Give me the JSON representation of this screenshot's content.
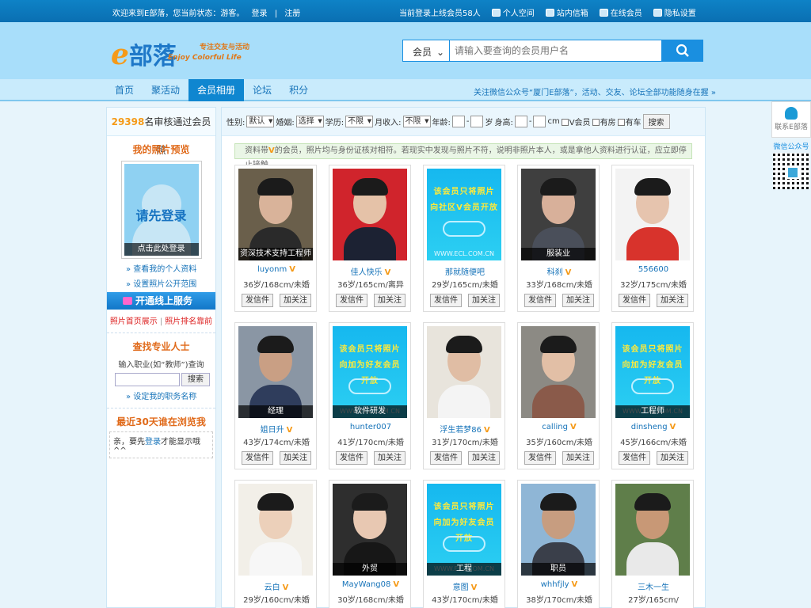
{
  "topbar": {
    "welcome": "欢迎来到E部落，您当前状态：游客。",
    "login": "登录",
    "separator": "|",
    "register": "注册",
    "online_count": "当前登录上线会员58人",
    "links": [
      {
        "icon": "home-icon",
        "label": "个人空间"
      },
      {
        "icon": "mail-icon",
        "label": "站内信箱"
      },
      {
        "icon": "users-icon",
        "label": "在线会员"
      },
      {
        "icon": "gear-icon",
        "label": "隐私设置"
      }
    ]
  },
  "header": {
    "logo_e": "e",
    "logo_text": "部落",
    "slogan": "专注交友与活动",
    "slogan_en": "Enjoy Colorful Life",
    "search_type": "会员",
    "search_placeholder": "请输入要查询的会员用户名",
    "search_icon": "search-icon"
  },
  "nav": {
    "items": [
      "首页",
      "聚活动",
      "会员相册",
      "论坛",
      "积分"
    ],
    "active_index": 2,
    "notice": "关注微信公众号“厦门E部落”，活动、交友、论坛全部功能随身在握 »"
  },
  "sidebar": {
    "count_number": "29398",
    "count_text": "名审核通过会员照",
    "photo_title": "我的照片预览",
    "photo_placeholder": "请先登录",
    "photo_caption": "点击此处登录",
    "link1": "» 查看我的个人资料",
    "link2": "» 设置照片公开范围",
    "service": "开通线上服务",
    "red1": "照片首页展示",
    "red_sep": "|",
    "red2": "照片排名靠前",
    "pro_title": "查找专业人士",
    "pro_hint": "输入职业(如“教师”)查询",
    "pro_search": "搜索",
    "pro_link": "» 设定我的职务名称",
    "recent_title": "最近30天谁在浏览我",
    "recent_prefix": "亲，要先",
    "recent_login": "登录",
    "recent_suffix": "才能显示哦^^"
  },
  "filter": {
    "gender_label": "性别:",
    "gender": "默认",
    "marriage_label": "婚姻:",
    "marriage": "选择",
    "edu_label": "学历:",
    "edu": "不限",
    "income_label": "月收入:",
    "income": "不限",
    "age_label": "年龄:",
    "age_sep": "-",
    "age_unit": "岁",
    "height_label": "身高:",
    "height_sep": "-",
    "height_unit": "cm",
    "check1": "V会员",
    "check2": "有房",
    "check3": "有车",
    "search": "搜索"
  },
  "notice": {
    "pre": "资料带",
    "v": "V",
    "post": "的会员，照片均与身份证核对相符。若现实中发现与照片不符，说明非照片本人，或是拿他人资料进行认证，应立即停止接触"
  },
  "members": [
    {
      "name": "luyonm",
      "vip": "V",
      "info": "36岁/168cm/未婚",
      "caption": "资深技术支持工程师",
      "promo": false,
      "skin": "#d9b39a",
      "bg": "#6a5f4b",
      "shirt": "#2a2a2a"
    },
    {
      "name": "佳人快乐",
      "vip": "V",
      "info": "36岁/165cm/离异",
      "caption": "",
      "promo": false,
      "skin": "#e5c2a8",
      "bg": "#d0242c",
      "shirt": "#1c2233"
    },
    {
      "name": "那就随便吧",
      "vip": "",
      "info": "29岁/165cm/未婚",
      "caption": "",
      "promo": true,
      "promo_text": "该会员只将照片向社区V会员开放",
      "promo_url": "WWW.ECL.COM.CN"
    },
    {
      "name": "科刹",
      "vip": "V",
      "info": "33岁/168cm/未婚",
      "caption": "服装业",
      "promo": false,
      "skin": "#d8b09a",
      "bg": "#3f3f3f",
      "shirt": "#4a4f5a"
    },
    {
      "name": "556600",
      "vip": "",
      "info": "32岁/175cm/未婚",
      "caption": "",
      "promo": false,
      "skin": "#e6c4ae",
      "bg": "#f3f3f3",
      "shirt": "#d8332c"
    },
    {
      "name": "姐日升",
      "vip": "V",
      "info": "43岁/174cm/未婚",
      "caption": "经理",
      "promo": false,
      "skin": "#c99f84",
      "bg": "#8a96a4",
      "shirt": "#2f3d5c"
    },
    {
      "name": "hunter007",
      "vip": "",
      "info": "41岁/170cm/未婚",
      "caption": "软件研发",
      "promo": true,
      "promo_text": "该会员只将照片向加为好友会员开放",
      "promo_url": "WWW.ECL.COM.CN"
    },
    {
      "name": "浮生若梦86",
      "vip": "V",
      "info": "31岁/170cm/未婚",
      "caption": "",
      "promo": false,
      "skin": "#e0bda4",
      "bg": "#e8e4dc",
      "shirt": "#f4f4f4"
    },
    {
      "name": "calling",
      "vip": "V",
      "info": "35岁/160cm/未婚",
      "caption": "",
      "promo": false,
      "skin": "#e2bfa6",
      "bg": "#8c8a84",
      "shirt": "#8a5a4a"
    },
    {
      "name": "dinsheng",
      "vip": "V",
      "info": "45岁/166cm/未婚",
      "caption": "工程师",
      "promo": true,
      "promo_text": "该会员只将照片向加为好友会员开放",
      "promo_url": "WWW.ECL.COM.CN"
    },
    {
      "name": "云白",
      "vip": "V",
      "info": "29岁/160cm/未婚",
      "caption": "",
      "promo": false,
      "skin": "#ecd0ba",
      "bg": "#f2efe8",
      "shirt": "#f7f7f7"
    },
    {
      "name": "MayWang08",
      "vip": "V",
      "info": "30岁/168cm/未婚",
      "caption": "外贸",
      "promo": false,
      "skin": "#e8c8b2",
      "bg": "#2e2e2e",
      "shirt": "#171717"
    },
    {
      "name": "意图",
      "vip": "V",
      "info": "43岁/170cm/未婚",
      "caption": "工程",
      "promo": true,
      "promo_text": "该会员只将照片向加为好友会员开放",
      "promo_url": "WWW.ECL.COM.CN"
    },
    {
      "name": "whhfjly",
      "vip": "V",
      "info": "38岁/170cm/未婚",
      "caption": "职员",
      "promo": false,
      "skin": "#c79d80",
      "bg": "#8fb6d6",
      "shirt": "#3a3f4a"
    },
    {
      "name": "三木一生",
      "vip": "",
      "info": "27岁/165cm/",
      "caption": "",
      "promo": false,
      "skin": "#c89876",
      "bg": "#5f7e4a",
      "shirt": "#e9e9e9"
    }
  ],
  "card_buttons": {
    "message": "发信件",
    "follow": "加关注"
  },
  "float": {
    "qq_label": "联系E部落",
    "wechat_label": "微信公众号"
  },
  "colors": {
    "primary": "#0f86d0",
    "accent": "#f59a18",
    "header_bg": "#a8defa"
  }
}
